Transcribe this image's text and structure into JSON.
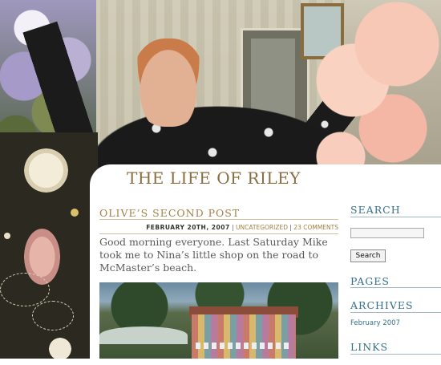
{
  "blog": {
    "title": "THE LIFE OF RILEY"
  },
  "post": {
    "title": "OLIVE’S SECOND POST",
    "date": "FEBRUARY 20TH, 2007",
    "separator": "|",
    "category": "UNCATEGORIZED",
    "comments": "23 COMMENTS",
    "body": "Good morning everyone. Last Saturday Mike took me to Nina’s little shop on the road to McMaster’s beach."
  },
  "sidebar": {
    "search_heading": "SEARCH",
    "search_value": "",
    "search_button": "Search",
    "pages_heading": "PAGES",
    "archives_heading": "ARCHIVES",
    "archive_items": [
      "February 2007"
    ],
    "links_heading": "LINKS"
  },
  "colors": {
    "title_gold": "#8a6d3e",
    "post_title": "#a07f45",
    "sidebar_blue": "#33708a"
  }
}
